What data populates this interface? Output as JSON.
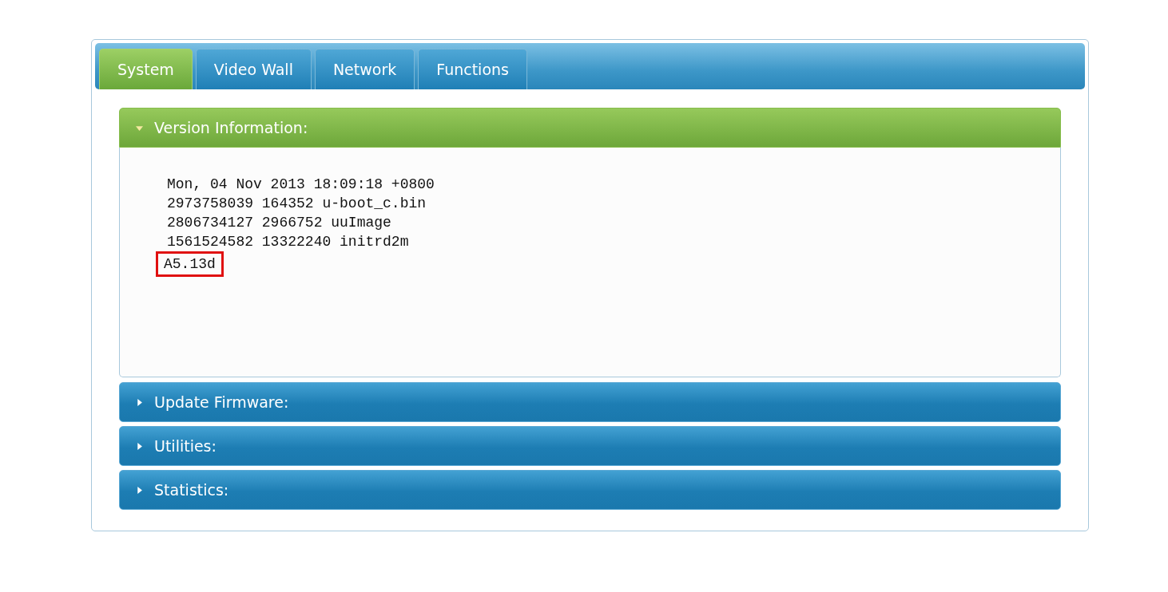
{
  "tabs": [
    {
      "label": "System",
      "selected": true
    },
    {
      "label": "Video Wall",
      "selected": false
    },
    {
      "label": "Network",
      "selected": false
    },
    {
      "label": "Functions",
      "selected": false
    }
  ],
  "sections": [
    {
      "title": "Version Information:",
      "expanded": true,
      "lines": [
        {
          "text": "Mon, 04 Nov 2013 18:09:18 +0800",
          "highlighted": false
        },
        {
          "text": "2973758039 164352 u-boot_c.bin",
          "highlighted": false
        },
        {
          "text": "2806734127 2966752 uuImage",
          "highlighted": false
        },
        {
          "text": "1561524582 13322240 initrd2m",
          "highlighted": false
        },
        {
          "text": "A5.13d",
          "highlighted": true
        }
      ]
    },
    {
      "title": "Update Firmware:",
      "expanded": false
    },
    {
      "title": "Utilities:",
      "expanded": false
    },
    {
      "title": "Statistics:",
      "expanded": false
    }
  ]
}
